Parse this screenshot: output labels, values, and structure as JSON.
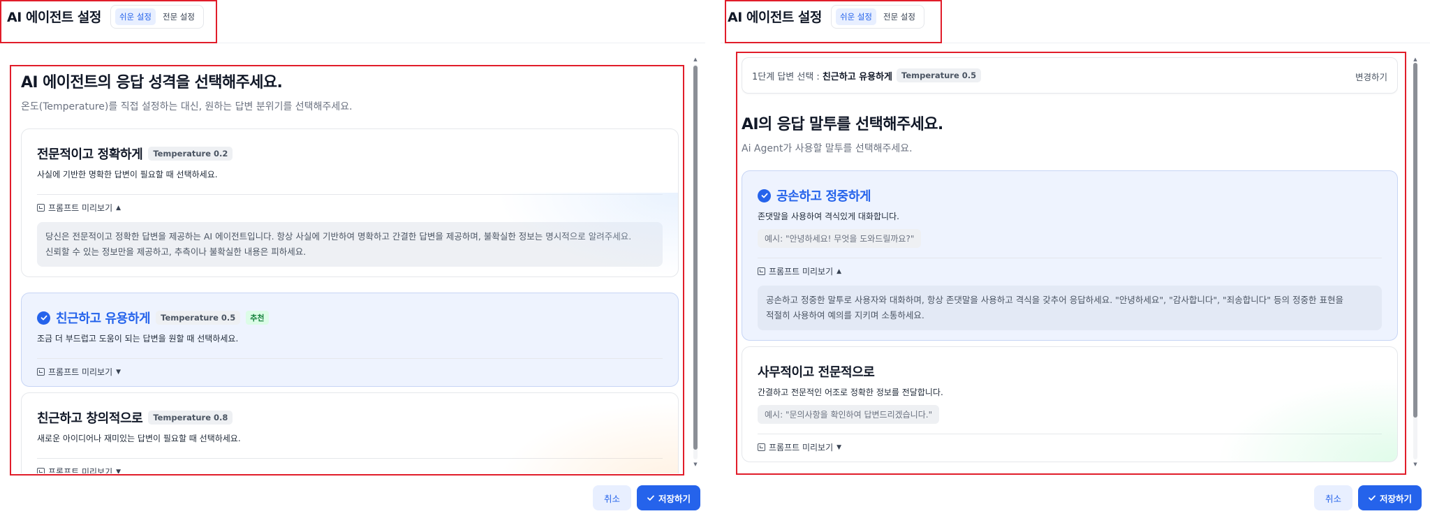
{
  "header": {
    "title": "AI 에이전트 설정",
    "mode_easy": "쉬운 설정",
    "mode_expert": "전문 설정"
  },
  "left": {
    "title": "AI 에이전트의 응답 성격을 선택해주세요.",
    "subtitle": "온도(Temperature)를 직접 설정하는 대신, 원하는 답변 분위기를 선택해주세요.",
    "preview_label": "프롬프트 미리보기",
    "cards": [
      {
        "title": "전문적이고 정확하게",
        "temp": "Temperature 0.2",
        "desc": "사실에 기반한 명확한 답변이 필요할 때 선택하세요.",
        "prompt_line1": "당신은 전문적이고 정확한 답변을 제공하는 AI 에이전트입니다. 항상 사실에 기반하여 명확하고 간결한 답변을 제공하며, 불확실한 정보는 명시적으로 알려주세요.",
        "prompt_line2": "신뢰할 수 있는 정보만을 제공하고, 추측이나 불확실한 내용은 피하세요."
      },
      {
        "title": "친근하고 유용하게",
        "temp": "Temperature 0.5",
        "badge": "추천",
        "desc": "조금 더 부드럽고 도움이 되는 답변을 원할 때 선택하세요."
      },
      {
        "title": "친근하고 창의적으로",
        "temp": "Temperature 0.8",
        "desc": "새로운 아이디어나 재미있는 답변이 필요할 때 선택하세요."
      }
    ]
  },
  "right": {
    "step": {
      "label": "1단계 답변 선택 :",
      "value": "친근하고 유용하게",
      "temp": "Temperature 0.5",
      "change": "변경하기"
    },
    "title": "AI의 응답 말투를 선택해주세요.",
    "subtitle": "Ai Agent가 사용할 말투를 선택해주세요.",
    "preview_label": "프롬프트 미리보기",
    "cards": [
      {
        "title": "공손하고 정중하게",
        "desc": "존댓말을 사용하여 격식있게 대화합니다.",
        "example": "예시: \"안녕하세요! 무엇을 도와드릴까요?\"",
        "prompt_line1": "공손하고 정중한 말투로 사용자와 대화하며, 항상 존댓말을 사용하고 격식을 갖추어 응답하세요. \"안녕하세요\", \"감사합니다\", \"죄송합니다\" 등의 정중한 표현을",
        "prompt_line2": "적절히 사용하여 예의를 지키며 소통하세요."
      },
      {
        "title": "사무적이고 전문적으로",
        "desc": "간결하고 전문적인 어조로 정확한 정보를 전달합니다.",
        "example": "예시: \"문의사항을 확인하여 답변드리겠습니다.\""
      }
    ]
  },
  "footer": {
    "cancel": "취소",
    "save": "저장하기"
  },
  "colors": {
    "accent": "#2563eb",
    "highlight_box": "#e11d2a",
    "selected_card_bg": "#eef3fe",
    "recommend_badge": "#dcfce7"
  }
}
